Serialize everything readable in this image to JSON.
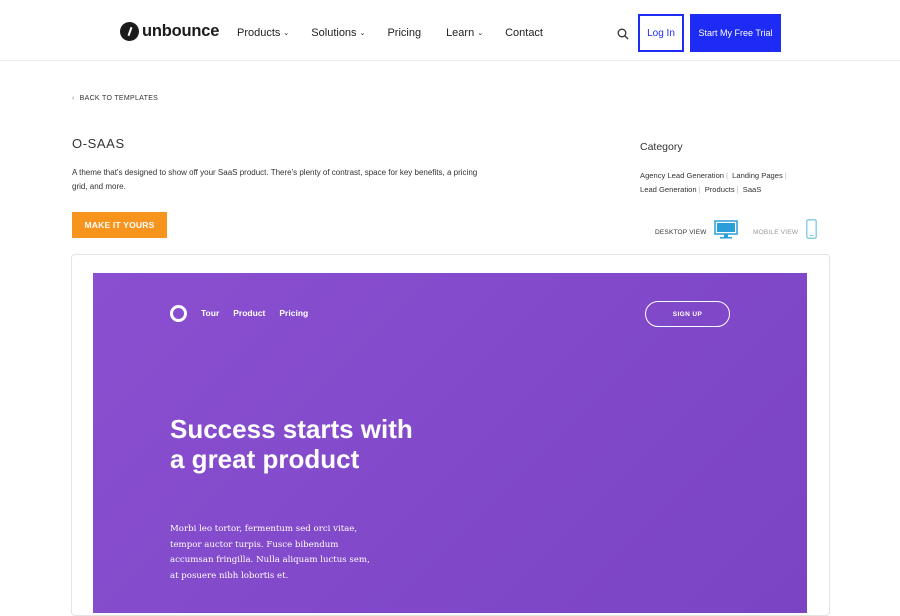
{
  "header": {
    "logo_text": "unbounce",
    "nav": [
      {
        "label": "Products",
        "has_dropdown": true
      },
      {
        "label": "Solutions",
        "has_dropdown": true
      },
      {
        "label": "Pricing",
        "has_dropdown": false
      },
      {
        "label": "Learn",
        "has_dropdown": true
      },
      {
        "label": "Contact",
        "has_dropdown": false
      }
    ],
    "search_icon": "search-icon",
    "login_label": "Log In",
    "trial_label": "Start My Free Trial"
  },
  "page": {
    "back_label": "BACK TO TEMPLATES",
    "template_title": "O-SAAS",
    "template_description": "A theme that's designed to show off your SaaS product. There's plenty of contrast, space for key benefits, a pricing grid, and more.",
    "make_it_yours_label": "MAKE IT YOURS",
    "category_heading": "Category",
    "categories": [
      "Agency Lead Generation",
      "Landing Pages",
      "Lead Generation",
      "Products",
      "SaaS"
    ],
    "desktop_view_label": "DESKTOP VIEW",
    "mobile_view_label": "MOBILE VIEW"
  },
  "preview": {
    "nav": [
      "Tour",
      "Product",
      "Pricing"
    ],
    "signup_label": "SIGN UP",
    "heading": "Success starts with a great product",
    "body": "Morbi leo tortor, fermentum sed orci vitae, tempor auctor turpis. Fusce bibendum accumsan fringilla. Nulla aliquam luctus sem, at posuere nibh lobortis et."
  },
  "colors": {
    "brand_blue": "#1e2bf5",
    "cta_orange": "#f7941d",
    "hero_purple": "#8149ca",
    "desktop_icon_blue": "#2a9ed8",
    "mobile_icon_blue": "#7cc8ea"
  }
}
